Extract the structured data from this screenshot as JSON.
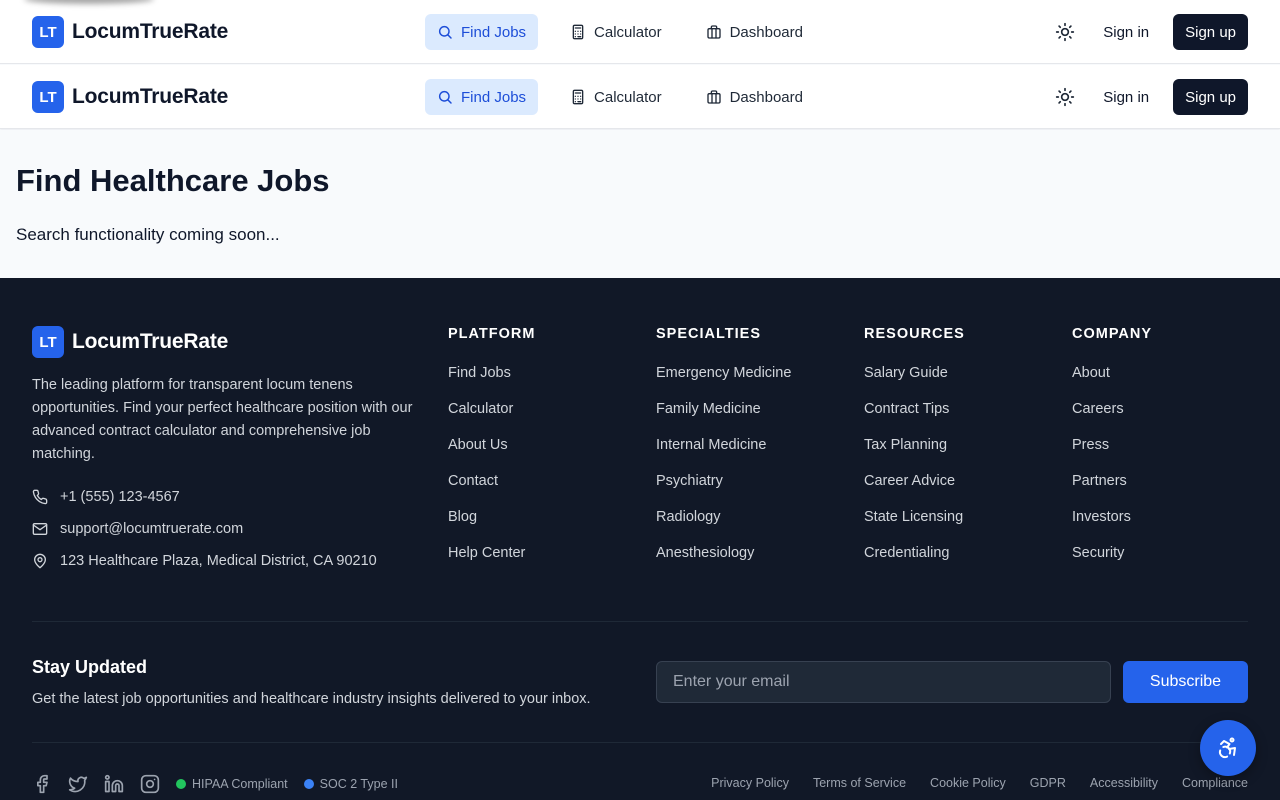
{
  "brand": {
    "logo_text": "LT",
    "name": "LocumTrueRate"
  },
  "nav": {
    "links": [
      {
        "label": "Find Jobs",
        "icon": "search-icon",
        "active": true
      },
      {
        "label": "Calculator",
        "icon": "calculator-icon",
        "active": false
      },
      {
        "label": "Dashboard",
        "icon": "briefcase-icon",
        "active": false
      }
    ],
    "theme_icon": "sun-icon",
    "sign_in": "Sign in",
    "sign_up": "Sign up"
  },
  "hero": {
    "title": "Find Healthcare Jobs",
    "subtitle": "Search functionality coming soon..."
  },
  "footer": {
    "description": "The leading platform for transparent locum tenens opportunities. Find your perfect healthcare position with our advanced contract calculator and comprehensive job matching.",
    "contact": {
      "phone": "+1 (555) 123-4567",
      "email": "support@locumtruerate.com",
      "address": "123 Healthcare Plaza, Medical District, CA 90210"
    },
    "columns": [
      {
        "heading": "PLATFORM",
        "links": [
          "Find Jobs",
          "Calculator",
          "About Us",
          "Contact",
          "Blog",
          "Help Center"
        ]
      },
      {
        "heading": "SPECIALTIES",
        "links": [
          "Emergency Medicine",
          "Family Medicine",
          "Internal Medicine",
          "Psychiatry",
          "Radiology",
          "Anesthesiology"
        ]
      },
      {
        "heading": "RESOURCES",
        "links": [
          "Salary Guide",
          "Contract Tips",
          "Tax Planning",
          "Career Advice",
          "State Licensing",
          "Credentialing"
        ]
      },
      {
        "heading": "COMPANY",
        "links": [
          "About",
          "Careers",
          "Press",
          "Partners",
          "Investors",
          "Security"
        ]
      }
    ],
    "newsletter": {
      "title": "Stay Updated",
      "subtitle": "Get the latest job opportunities and healthcare industry insights delivered to your inbox.",
      "placeholder": "Enter your email",
      "button": "Subscribe"
    },
    "social_icons": [
      "facebook-icon",
      "twitter-icon",
      "linkedin-icon",
      "instagram-icon"
    ],
    "badges": [
      {
        "label": "HIPAA Compliant",
        "color": "#22c55e"
      },
      {
        "label": "SOC 2 Type II",
        "color": "#3b82f6"
      }
    ],
    "legal": [
      "Privacy Policy",
      "Terms of Service",
      "Cookie Policy",
      "GDPR",
      "Accessibility",
      "Compliance"
    ]
  },
  "colors": {
    "accent": "#2563eb",
    "active_nav_bg": "#dbeafe",
    "dark": "#0f172a",
    "footer_bg": "#111827"
  }
}
